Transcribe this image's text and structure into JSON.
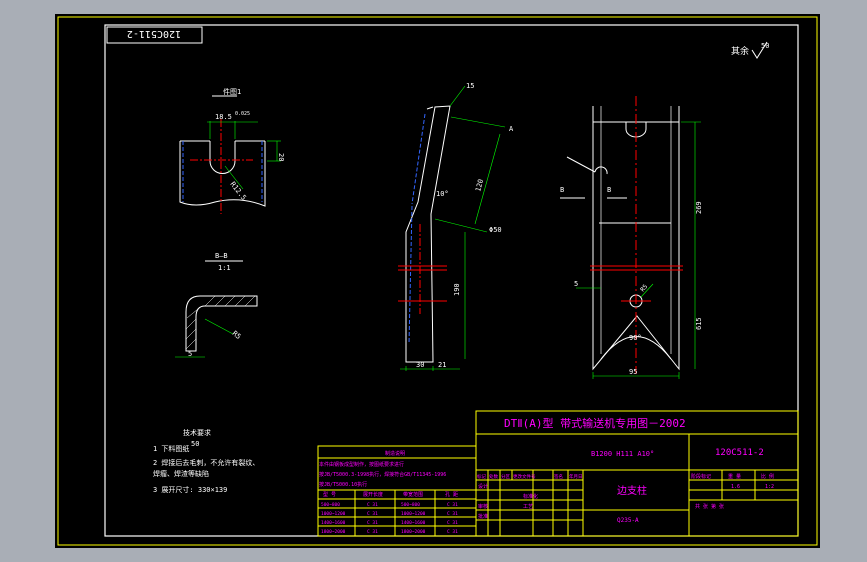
{
  "drawing": {
    "code_box": "120C511-2",
    "roughness_note": "其余",
    "roughness_value": "50",
    "detail_title": "件图1",
    "section_label": "B—B",
    "section_scale": "1:1"
  },
  "dims": {
    "left_width": "18.5",
    "left_tol": "0.025",
    "left_height": "20",
    "left_radius": "R12.5",
    "section_radius": "R5",
    "section_gap": "5",
    "mid_top": "15",
    "mid_angle": "10°",
    "mid_len1": "120",
    "mid_hole": "Φ50",
    "mid_len2": "190",
    "mid_w1": "30",
    "mid_w2": "21",
    "mid_point": "A",
    "right_height": "269",
    "right_lower": "615",
    "right_angle": "90°",
    "right_width": "95",
    "right_r": "R5",
    "right_five": "5",
    "right_b_left": "B",
    "right_b_right": "B"
  },
  "notes": {
    "title": "技术要求",
    "roughness": "50",
    "items": [
      "1  下料图纸",
      "2  焊接后去毛刺，不允许有裂纹、",
      "   焊瘤、焊渣等缺陷",
      "3  展开尺寸:  330×139"
    ]
  },
  "table": {
    "title": "制造说明",
    "rows": [
      "本件由钢板成型制作，按图纸要求进行",
      "按JB/T5000.3-1998执行，焊接符合GB/T11345-1996",
      "按JB/T5000.10执行"
    ],
    "headers": [
      "型  号",
      "展开长度",
      "带宽范围",
      "孔  距"
    ],
    "data": [
      [
        "500~800",
        "C 31",
        "500~800",
        "C 31"
      ],
      [
        "1000~1200",
        "C 31",
        "1000~1200",
        "C 31"
      ],
      [
        "1400~1600",
        "C 31",
        "1400~1600",
        "C 31"
      ],
      [
        "1800~2000",
        "C 31",
        "1800~2000",
        "C 31"
      ]
    ]
  },
  "title_block": {
    "series": "DTⅡ(A)型  带式输送机专用图－2002",
    "spec": "B1200 H111 A10°",
    "number": "120C511-2",
    "part_name": "边支柱",
    "material": "Q235-A",
    "stage": "阶段标记",
    "weight": "重  量",
    "ratio": "比  例",
    "weight_val": "1.6",
    "ratio_val": "1:2",
    "sheet": "共    张    第    张",
    "sign_cols": [
      "标记",
      "处数",
      "分区",
      "更改文件号",
      "签名",
      "年月日"
    ],
    "sign_rows": [
      "设计",
      "标准化",
      "审核",
      "工艺",
      "批准"
    ]
  },
  "colors": {
    "background": "#000000",
    "frame": "#ffffff",
    "title_frame": "#ffff00",
    "dimension": "#00ff00",
    "text": "#ff00ff",
    "centerline": "#ff0000",
    "hidden": "#0000ff",
    "outer": "#a9aeb6"
  }
}
